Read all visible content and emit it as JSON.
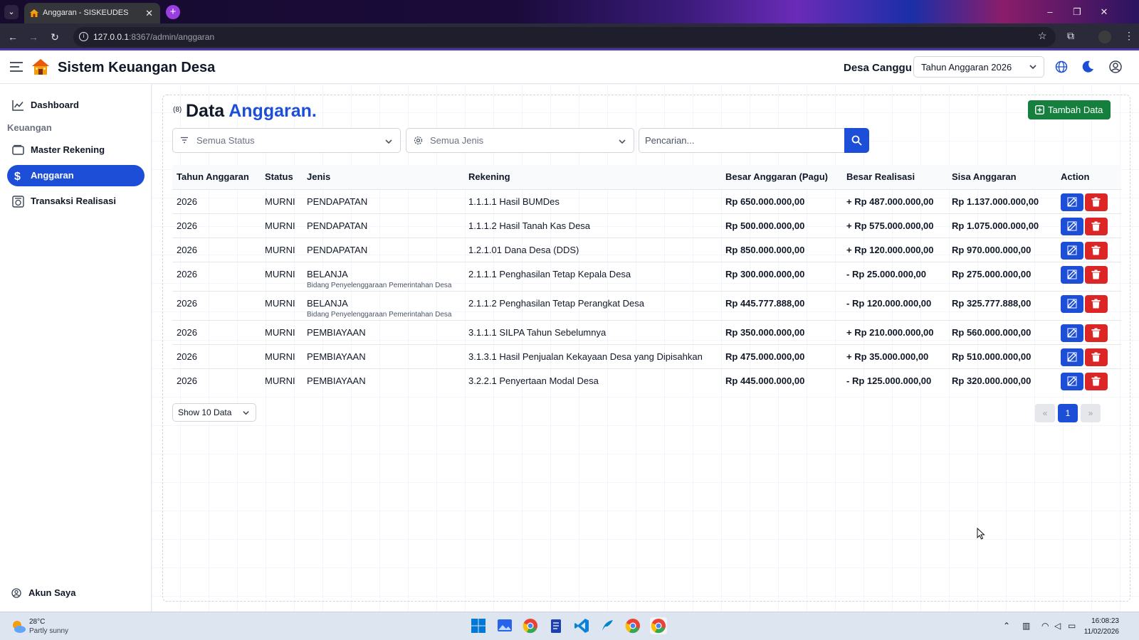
{
  "browser": {
    "tab_title": "Anggaran - SISKEUDES",
    "tab_close": "✕",
    "new_tab": "+",
    "url_host": "127.0.0.1",
    "url_rest": ":8367/admin/anggaran",
    "window_controls": [
      "–",
      "❐",
      "✕"
    ]
  },
  "header": {
    "app_title": "Sistem Keuangan Desa",
    "village": "Desa Canggu",
    "year_select": "Tahun Anggaran 2026"
  },
  "sidebar": {
    "items": [
      {
        "label": "Dashboard",
        "icon": "chart-line-icon"
      },
      {
        "label": "Master Rekening",
        "icon": "wallet-icon"
      },
      {
        "label": "Anggaran",
        "icon": "dollar-icon"
      },
      {
        "label": "Transaksi Realisasi",
        "icon": "transaction-icon"
      }
    ],
    "section_label": "Keuangan",
    "account": "Akun Saya"
  },
  "main": {
    "count": "(8)",
    "title_part1": "Data",
    "title_part2": "Anggaran",
    "title_dot": ".",
    "add_button": "Tambah Data",
    "filter_status": "Semua Status",
    "filter_jenis": "Semua Jenis",
    "search_placeholder": "Pencarian...",
    "columns": [
      "Tahun Anggaran",
      "Status",
      "Jenis",
      "Rekening",
      "Besar Anggaran (Pagu)",
      "Besar Realisasi",
      "Sisa Anggaran",
      "Action"
    ],
    "rows": [
      {
        "tahun": "2026",
        "status": "MURNI",
        "jenis": "PENDAPATAN",
        "bidang": "",
        "rekening": "1.1.1.1 Hasil BUMDes",
        "pagu": "Rp 650.000.000,00",
        "realisasi": "+ Rp 487.000.000,00",
        "sisa": "Rp 1.137.000.000,00"
      },
      {
        "tahun": "2026",
        "status": "MURNI",
        "jenis": "PENDAPATAN",
        "bidang": "",
        "rekening": "1.1.1.2 Hasil Tanah Kas Desa",
        "pagu": "Rp 500.000.000,00",
        "realisasi": "+ Rp 575.000.000,00",
        "sisa": "Rp 1.075.000.000,00"
      },
      {
        "tahun": "2026",
        "status": "MURNI",
        "jenis": "PENDAPATAN",
        "bidang": "",
        "rekening": "1.2.1.01 Dana Desa (DDS)",
        "pagu": "Rp 850.000.000,00",
        "realisasi": "+ Rp 120.000.000,00",
        "sisa": "Rp 970.000.000,00"
      },
      {
        "tahun": "2026",
        "status": "MURNI",
        "jenis": "BELANJA",
        "bidang": "Bidang Penyelenggaraan Pemerintahan Desa",
        "rekening": "2.1.1.1 Penghasilan Tetap Kepala Desa",
        "pagu": "Rp 300.000.000,00",
        "realisasi": "- Rp 25.000.000,00",
        "sisa": "Rp 275.000.000,00"
      },
      {
        "tahun": "2026",
        "status": "MURNI",
        "jenis": "BELANJA",
        "bidang": "Bidang Penyelenggaraan Pemerintahan Desa",
        "rekening": "2.1.1.2 Penghasilan Tetap Perangkat Desa",
        "pagu": "Rp 445.777.888,00",
        "realisasi": "- Rp 120.000.000,00",
        "sisa": "Rp 325.777.888,00"
      },
      {
        "tahun": "2026",
        "status": "MURNI",
        "jenis": "PEMBIAYAAN",
        "bidang": "",
        "rekening": "3.1.1.1 SILPA Tahun Sebelumnya",
        "pagu": "Rp 350.000.000,00",
        "realisasi": "+ Rp 210.000.000,00",
        "sisa": "Rp 560.000.000,00"
      },
      {
        "tahun": "2026",
        "status": "MURNI",
        "jenis": "PEMBIAYAAN",
        "bidang": "",
        "rekening": "3.1.3.1 Hasil Penjualan Kekayaan Desa yang Dipisahkan",
        "pagu": "Rp 475.000.000,00",
        "realisasi": "+ Rp 35.000.000,00",
        "sisa": "Rp 510.000.000,00"
      },
      {
        "tahun": "2026",
        "status": "MURNI",
        "jenis": "PEMBIAYAAN",
        "bidang": "",
        "rekening": "3.2.2.1 Penyertaan Modal Desa",
        "pagu": "Rp 445.000.000,00",
        "realisasi": "- Rp 125.000.000,00",
        "sisa": "Rp 320.000.000,00"
      }
    ],
    "show_select": "Show 10 Data",
    "pagination": {
      "prev": "«",
      "current": "1",
      "next": "»"
    }
  },
  "taskbar": {
    "temperature": "28°C",
    "weather": "Partly sunny",
    "time": "16:08:23",
    "date": "11/02/2026"
  },
  "colors": {
    "primary": "#1d4ed8",
    "success": "#15803d",
    "danger": "#dc2626"
  }
}
